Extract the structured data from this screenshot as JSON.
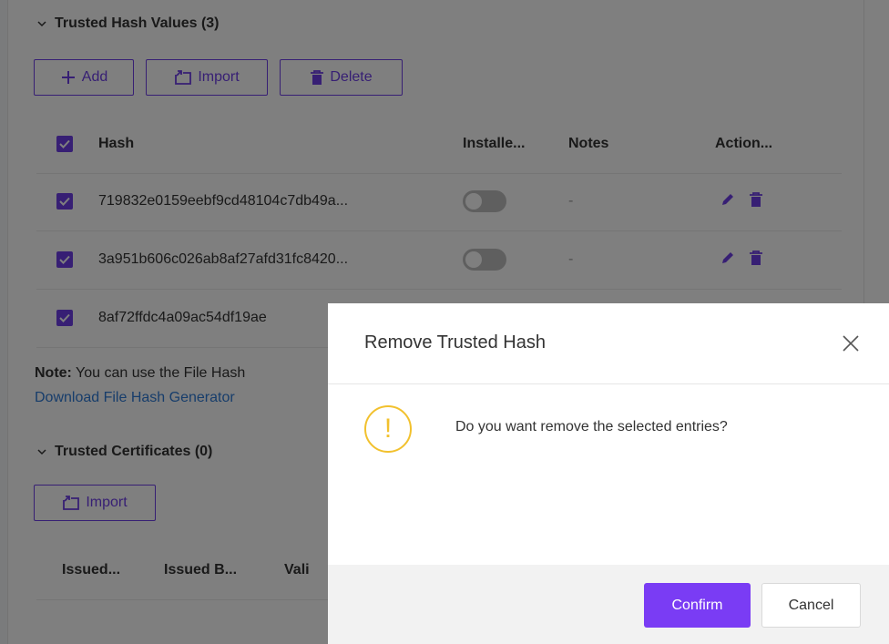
{
  "hash_section": {
    "title": "Trusted Hash Values (3)",
    "add_label": "Add",
    "import_label": "Import",
    "delete_label": "Delete",
    "columns": {
      "hash": "Hash",
      "installed": "Installe...",
      "notes": "Notes",
      "actions": "Action..."
    },
    "rows": [
      {
        "hash": "719832e0159eebf9cd48104c7db49a...",
        "notes": "-"
      },
      {
        "hash": "3a951b606c026ab8af27afd31fc8420...",
        "notes": "-"
      },
      {
        "hash": "8af72ffdc4a09ac54df19ae",
        "notes": ""
      }
    ]
  },
  "note": {
    "label": "Note:",
    "text": " You can use the File Hash",
    "link": "Download File Hash Generator"
  },
  "cert_section": {
    "title": "Trusted Certificates (0)",
    "import_label": "Import",
    "columns": {
      "issued_to": "Issued...",
      "issued_by": "Issued B...",
      "valid": "Vali"
    }
  },
  "modal": {
    "title": "Remove Trusted Hash",
    "message": "Do you want remove the selected entries?",
    "warning_glyph": "!",
    "confirm_label": "Confirm",
    "cancel_label": "Cancel"
  },
  "colors": {
    "accent": "#6e3fe8",
    "confirm": "#7a3cf4",
    "warning": "#f2c12e",
    "link": "#2f7bd6"
  }
}
